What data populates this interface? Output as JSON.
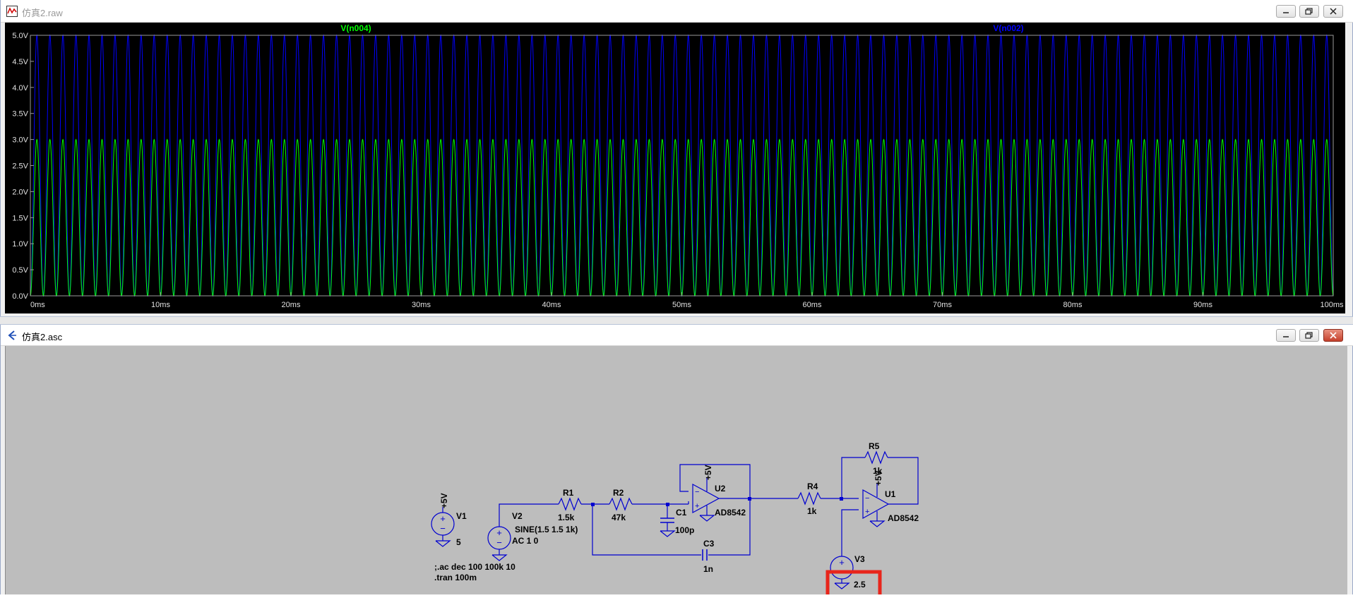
{
  "waveform_window": {
    "title": "仿真2.raw",
    "traces": [
      {
        "name": "V(n004)",
        "color": "#00ff00"
      },
      {
        "name": "V(n002)",
        "color": "#0000ff"
      }
    ],
    "y_ticks": [
      "5.0V",
      "4.5V",
      "4.0V",
      "3.5V",
      "3.0V",
      "2.5V",
      "2.0V",
      "1.5V",
      "1.0V",
      "0.5V",
      "0.0V"
    ],
    "x_ticks": [
      "0ms",
      "10ms",
      "20ms",
      "30ms",
      "40ms",
      "50ms",
      "60ms",
      "70ms",
      "80ms",
      "90ms",
      "100ms"
    ]
  },
  "schematic_window": {
    "title": "仿真2.asc",
    "labels": {
      "v1_name": "V1",
      "v1_value": "5",
      "v1_supply": "+5V",
      "v2_name": "V2",
      "v2_value1": "SINE(1.5 1.5 1k)",
      "v2_value2": "AC 1 0",
      "r1_name": "R1",
      "r1_value": "1.5k",
      "r2_name": "R2",
      "r2_value": "47k",
      "c1_name": "C1",
      "c1_value": "100p",
      "c3_name": "C3",
      "c3_value": "1n",
      "u2_name": "U2",
      "u2_model": "AD8542",
      "u2_supply": "+5V",
      "r4_name": "R4",
      "r4_value": "1k",
      "r5_name": "R5",
      "r5_value": "1k",
      "u1_name": "U1",
      "u1_model": "AD8542",
      "u1_supply": "+5V",
      "v3_name": "V3",
      "v3_value": "2.5",
      "directive1": ";.ac dec 100 100k 10",
      "directive2": ".tran 100m"
    },
    "highlight_color": "#e8251b"
  },
  "chart_data": {
    "type": "line",
    "title": "",
    "xlabel": "",
    "ylabel": "",
    "xlim": [
      0,
      100
    ],
    "ylim": [
      0,
      5
    ],
    "x_unit": "ms",
    "y_unit": "V",
    "grid": false,
    "series": [
      {
        "name": "V(n004)",
        "color": "#00ff00",
        "waveform": "sine",
        "frequency_khz": 1,
        "min": 0,
        "max": 3,
        "x_start": 0,
        "x_end": 100
      },
      {
        "name": "V(n002)",
        "color": "#0000ff",
        "waveform": "sine",
        "frequency_khz": 1,
        "min": 0,
        "max": 5,
        "x_start": 0,
        "x_end": 100
      }
    ]
  }
}
